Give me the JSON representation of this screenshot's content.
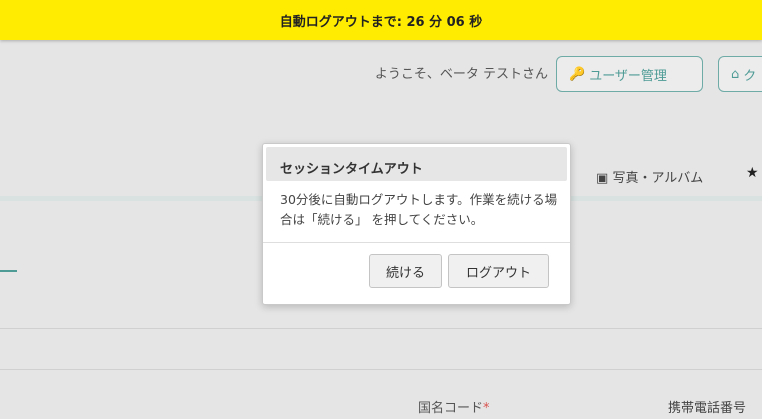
{
  "banner": {
    "text": "自動ログアウトまで: 26 分 06 秒"
  },
  "header": {
    "welcome": "ようこそ、ベータ テストさん",
    "users_button": "ユーザー管理",
    "home_button": "ク"
  },
  "nav": {
    "photo_album": "写真・アルバム"
  },
  "form": {
    "country_code_label": "国名コード",
    "required_mark": "*",
    "mobile_label": "携帯電話番号"
  },
  "dialog": {
    "title": "セッションタイムアウト",
    "body": "30分後に自動ログアウトします。作業を続ける場合は「続ける」 を押してください。",
    "continue_button": "続ける",
    "logout_button": "ログアウト"
  },
  "icons": [
    "key-icon",
    "home-icon",
    "image-icon",
    "star-icon"
  ],
  "colors": {
    "banner": "#ffec00",
    "accent": "#4e9b96",
    "required": "#d9534f"
  }
}
